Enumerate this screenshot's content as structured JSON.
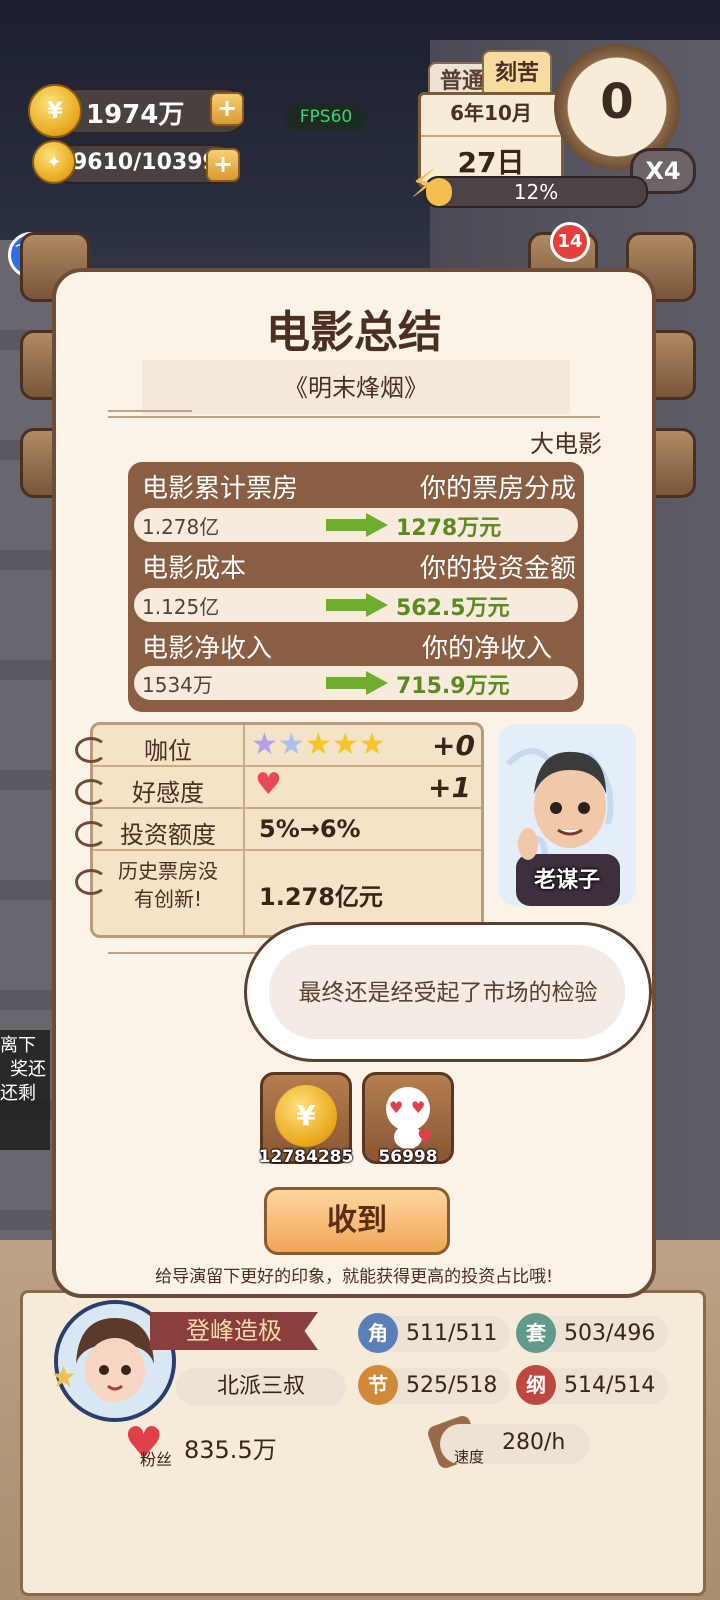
{
  "hud": {
    "money": "1974万",
    "energy_points": "9610/10399",
    "fps": "FPS60",
    "mode_tabs": [
      "普通",
      "刻苦"
    ],
    "date_year_month": "6年10月",
    "date_day": "27日",
    "clock_value": "0",
    "speed_multiplier": "X4",
    "progress_label": "12%",
    "progress_fraction": 0.12,
    "notification_count": "14",
    "offline_lines": [
      "离下",
      "奖还",
      "还剩"
    ]
  },
  "modal": {
    "title": "电影总结",
    "movie_name": "《明末烽烟》",
    "movie_type": "大电影",
    "box_office": {
      "rows": [
        {
          "left_label": "电影累计票房",
          "right_label": "你的票房分成",
          "left_value": "1.278亿",
          "right_value": "1278万元"
        },
        {
          "left_label": "电影成本",
          "right_label": "你的投资金额",
          "left_value": "1.125亿",
          "right_value": "562.5万元"
        },
        {
          "left_label": "电影净收入",
          "right_label": "你的净收入",
          "left_value": "1534万",
          "right_value": "715.9万元"
        }
      ]
    },
    "stats": {
      "rank_label": "咖位",
      "rank_stars": 5,
      "rank_change": "+0",
      "favor_label": "好感度",
      "favor_change": "+1",
      "invest_label": "投资额度",
      "invest_value": "5%→6%",
      "history_label": "历史票房没有创新!",
      "history_label_line1": "历史票房没",
      "history_label_line2": "有创新!",
      "history_value": "1.278亿元"
    },
    "director_name": "老谋子",
    "speech": "最终还是经受起了市场的检验",
    "rewards": [
      {
        "icon": "coin-icon",
        "count": "12784285"
      },
      {
        "icon": "fan-love-icon",
        "count": "56998"
      }
    ],
    "confirm_label": "收到",
    "tip": "给导演留下更好的印象，就能获得更高的投资占比哦!"
  },
  "profile": {
    "rank_title": "登峰造极",
    "player_name": "北派三叔",
    "attributes": [
      {
        "icon": "角",
        "value": "511/511",
        "color": "#5b7fb8"
      },
      {
        "icon": "套",
        "value": "503/496",
        "color": "#5f9a8a"
      },
      {
        "icon": "节",
        "value": "525/518",
        "color": "#d08a3a"
      },
      {
        "icon": "纲",
        "value": "514/514",
        "color": "#c0473f"
      }
    ],
    "fans_label": "粉丝",
    "fans_value": "835.5万",
    "speed_label": "速度",
    "speed_value": "280/h"
  }
}
